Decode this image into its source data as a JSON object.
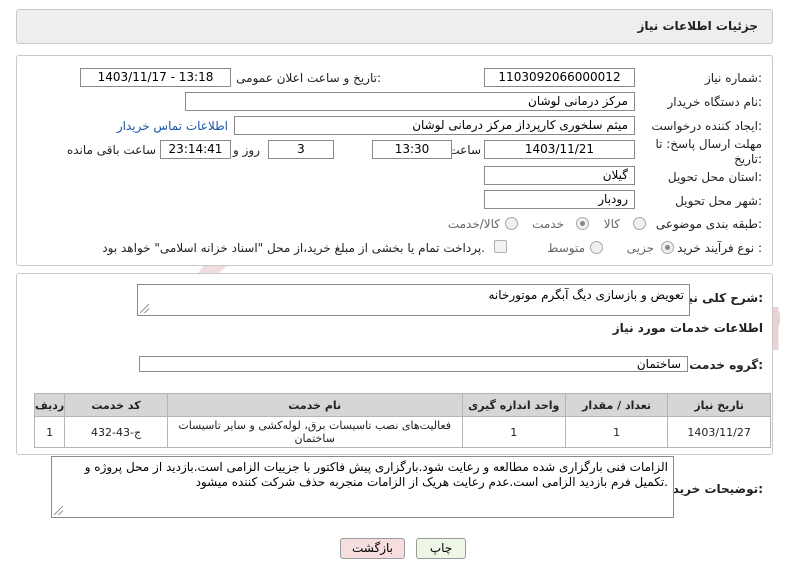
{
  "header": {
    "title": "جزئیات اطلاعات نیاز"
  },
  "form": {
    "need_number": {
      "label": "شماره نیاز:",
      "value": "1103092066000012"
    },
    "announce_datetime": {
      "label": "تاریخ و ساعت اعلان عمومی:",
      "value": "1403/11/17 - 13:18"
    },
    "buyer_org": {
      "label": "نام دستگاه خریدار:",
      "value": "مرکز درمانی لوشان"
    },
    "requester": {
      "label": "ایجاد کننده درخواست:",
      "value": "میثم سلخوری کارپرداز مرکز درمانی لوشان",
      "contact_link": "اطلاعات تماس خریدار"
    },
    "deadline": {
      "label_line1": "مهلت ارسال پاسخ: تا",
      "label_line2": "تاریخ:",
      "date": "1403/11/21",
      "time_label": "ساعت",
      "time": "13:30",
      "days": "3",
      "days_label": "روز و",
      "remaining": "23:14:41",
      "remaining_label": "ساعت باقی مانده"
    },
    "province": {
      "label": "استان محل تحویل:",
      "value": "گیلان"
    },
    "city": {
      "label": "شهر محل تحویل:",
      "value": "رودبار"
    },
    "category": {
      "label": "طبقه بندی موضوعی:",
      "options": [
        "کالا",
        "خدمت",
        "کالا/خدمت"
      ],
      "selected": "خدمت"
    },
    "process": {
      "label": "نوع فرآیند خرید :",
      "options": [
        "جزیی",
        "متوسط"
      ],
      "selected": "جزیی",
      "payment_note": "پرداخت تمام یا بخشی از مبلغ خرید،از محل \"اسناد خزانه اسلامی\" خواهد بود."
    }
  },
  "summary": {
    "label": "شرح کلی نیاز:",
    "value": "تعویض و بازسازی دیگ آبگرم موتورخانه"
  },
  "services": {
    "section_title": "اطلاعات خدمات مورد نیاز",
    "group_label": "گروه خدمت:",
    "group_value": "ساختمان",
    "table": {
      "headers": [
        "ردیف",
        "کد خدمت",
        "نام خدمت",
        "واحد اندازه گیری",
        "تعداد / مقدار",
        "تاریخ نیاز"
      ],
      "rows": [
        [
          "1",
          "ج-43-432",
          "فعالیت‌های نصب تاسیسات برق، لوله‌کشی و سایر تاسیسات ساختمان",
          "1",
          "1",
          "1403/11/27"
        ]
      ]
    }
  },
  "buyer_notes": {
    "label": "توضیحات خریدار:",
    "value": "الزامات فنی بارگزاری شده مطالعه و رعایت شود.بارگزاری پیش فاکتور با جزییات الزامی است.بازدید از محل پروژه و تکمیل فرم بازدید الزامی است.عدم رعایت هریک از الزامات منجربه حذف شرکت کننده میشود."
  },
  "buttons": {
    "print": "چاپ",
    "back": "بازگشت"
  },
  "watermark": {
    "text": "AriaTender.neT"
  },
  "colors": {
    "link": "#1a53a6",
    "back_button": "#f6dede",
    "print_button": "#eef6e6",
    "watermark": "#e4c4c4"
  }
}
